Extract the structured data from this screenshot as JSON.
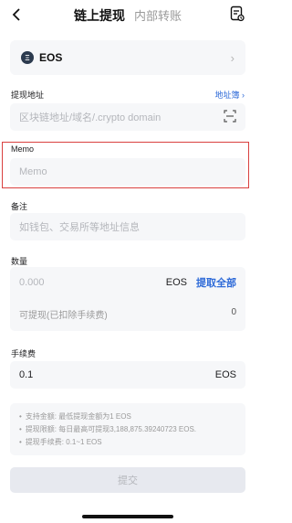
{
  "header": {
    "tab_active": "链上提现",
    "tab_inactive": "内部转账"
  },
  "coin": {
    "icon_text": "Ξ",
    "name": "EOS"
  },
  "address": {
    "label": "提现地址",
    "link": "地址簿",
    "placeholder": "区块链地址/域名/.crypto domain"
  },
  "memo": {
    "label": "Memo",
    "placeholder": "Memo"
  },
  "note": {
    "label": "备注",
    "placeholder": "如钱包、交易所等地址信息"
  },
  "amount": {
    "label": "数量",
    "placeholder": "0.000",
    "unit": "EOS",
    "max_action": "提取全部",
    "available_label": "可提现(已扣除手续费)",
    "available_value": "0"
  },
  "fee": {
    "label": "手续费",
    "value": "0.1",
    "unit": "EOS"
  },
  "info": {
    "lines": [
      "支持金额: 最低提现金额为1 EOS",
      "提现限额: 每日最高可提现3,188,875.39240723 EOS.",
      "提现手续费: 0.1~1 EOS"
    ]
  },
  "submit": {
    "label": "提交"
  },
  "colors": {
    "accent": "#2f6bd8",
    "highlight_border": "#d9403f",
    "field_bg": "#f6f7f9"
  }
}
